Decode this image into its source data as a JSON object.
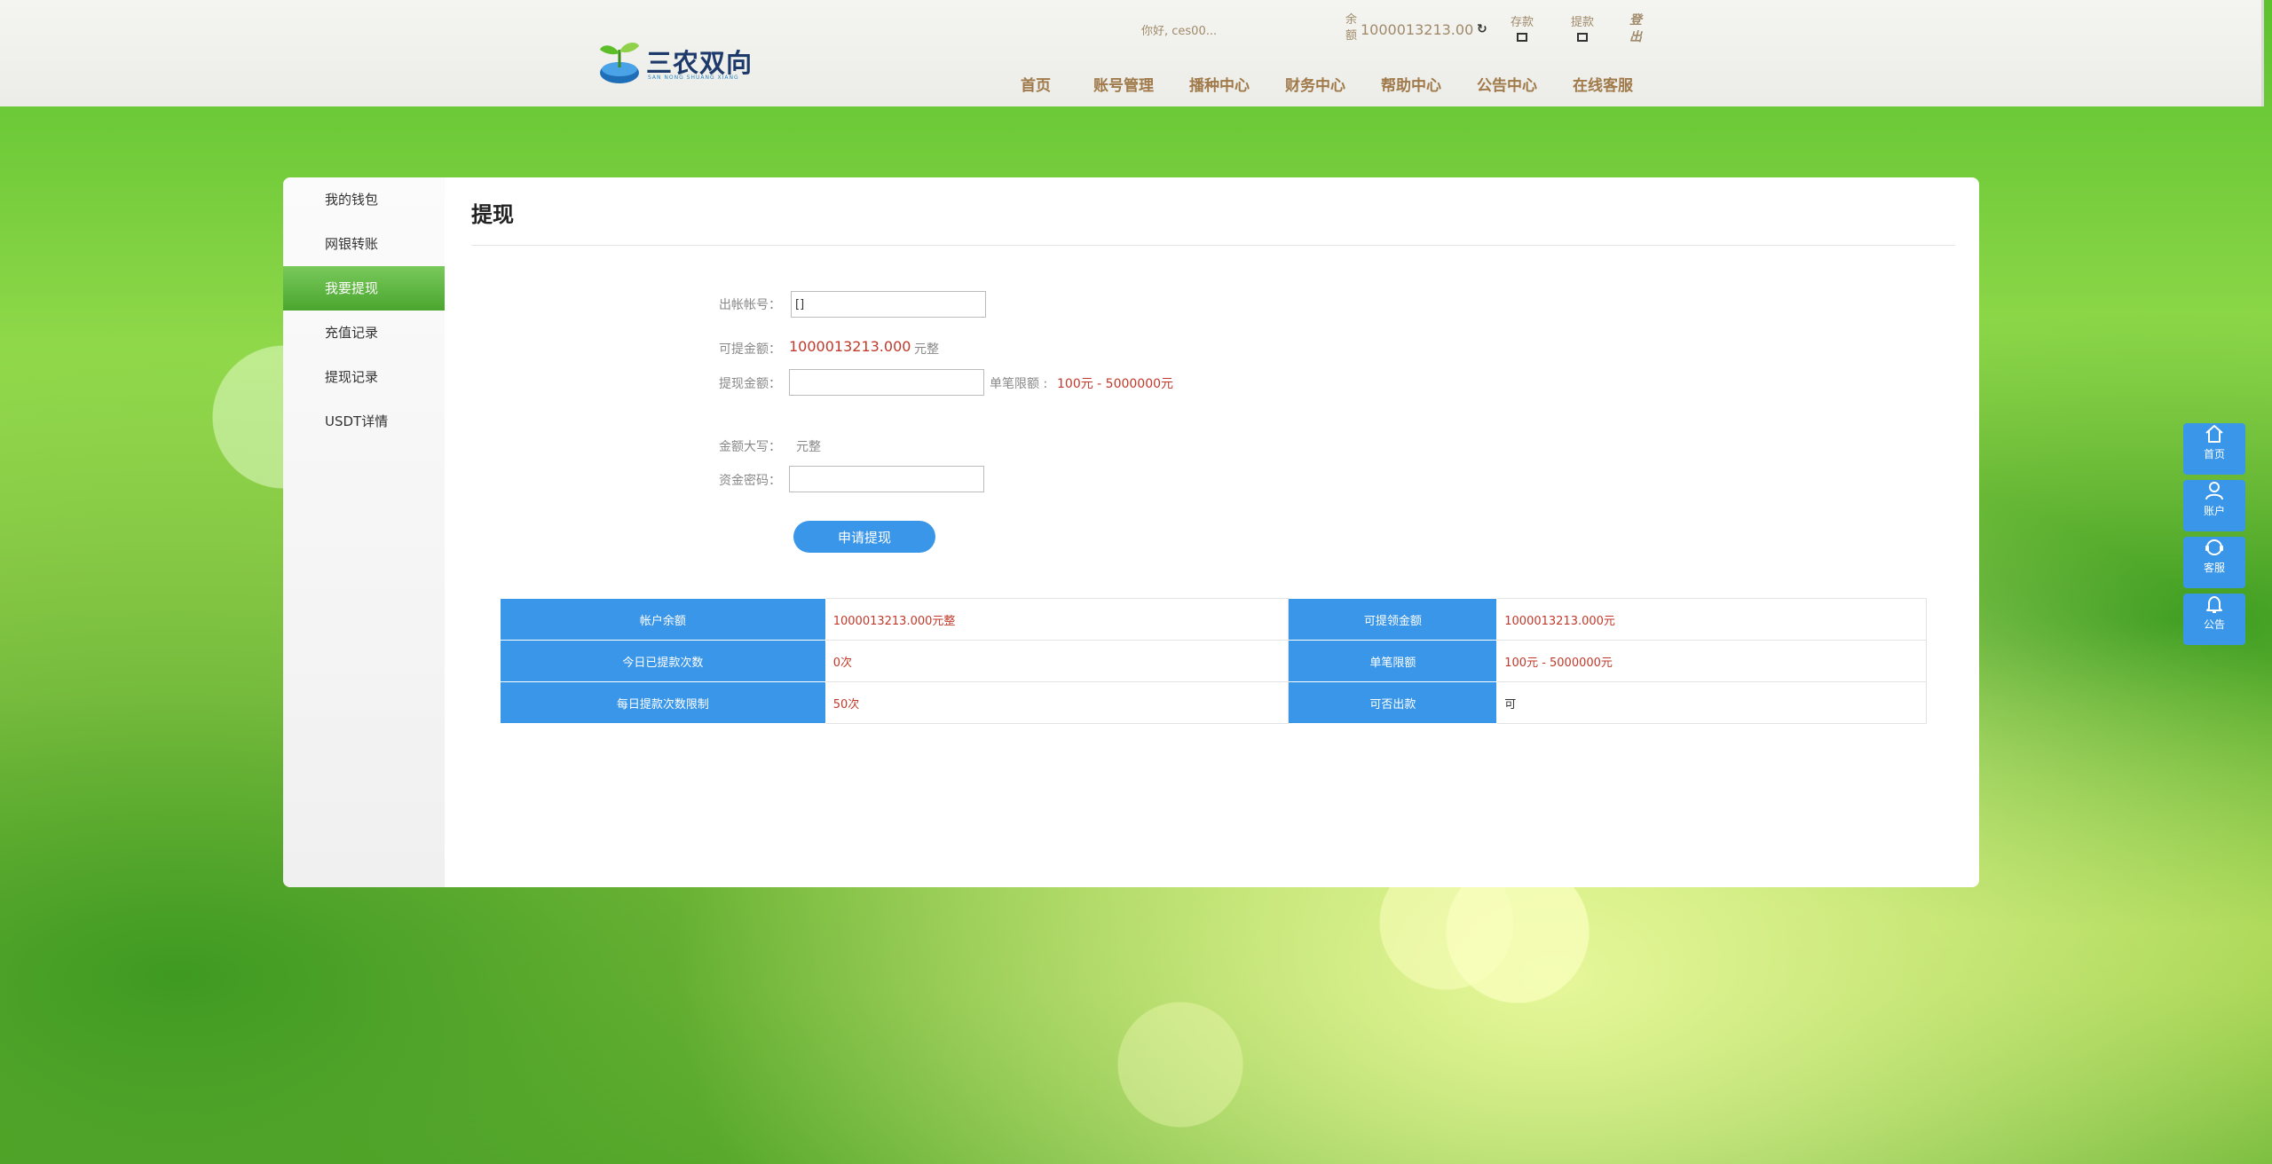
{
  "header": {
    "logo_text": "三农双向",
    "logo_sub": "SAN NONG SHUANG XIANG",
    "greeting": "你好, ces00...",
    "balance_label": "余额",
    "balance_value": "1000013213.00",
    "deposit_label": "存款",
    "withdraw_label": "提款",
    "logout_label": "登出",
    "nav": [
      "首页",
      "账号管理",
      "播种中心",
      "财务中心",
      "帮助中心",
      "公告中心",
      "在线客服"
    ]
  },
  "sidebar": {
    "items": [
      {
        "label": "我的钱包"
      },
      {
        "label": "网银转账"
      },
      {
        "label": "我要提现"
      },
      {
        "label": "充值记录"
      },
      {
        "label": "提现记录"
      },
      {
        "label": "USDT详情"
      }
    ],
    "active_index": 2
  },
  "main": {
    "title": "提现",
    "account_label": "出帐帐号：",
    "account_value": "[]",
    "available_label": "可提金额：",
    "available_value": "1000013213.000",
    "available_unit": "元整",
    "amount_label": "提现金额：",
    "amount_value": "",
    "limit_label": "单笔限额 :",
    "limit_value": "100元 - 5000000元",
    "uppercase_label": "金额大写：",
    "uppercase_unit": "元整",
    "password_label": "资金密码：",
    "password_value": "",
    "submit_label": "申请提现"
  },
  "info_table": {
    "rows": [
      {
        "l1": "帐户余额",
        "v1": "1000013213.000元整",
        "l2": "可提领金额",
        "v2": "1000013213.000元"
      },
      {
        "l1": "今日已提款次数",
        "v1": "0次",
        "l2": "单笔限额",
        "v2": "100元 - 5000000元"
      },
      {
        "l1": "每日提款次数限制",
        "v1": "50次",
        "l2": "可否出款",
        "v2": "可"
      }
    ]
  },
  "float_bar": {
    "items": [
      {
        "label": "首页",
        "icon": "home-icon"
      },
      {
        "label": "账户",
        "icon": "user-icon"
      },
      {
        "label": "客服",
        "icon": "headset-icon"
      },
      {
        "label": "公告",
        "icon": "bell-icon"
      }
    ]
  },
  "colors": {
    "accent_blue": "#3a96e8",
    "active_green": "#4aa62f",
    "amount_red": "#c0392b",
    "nav_brown": "#a07a4a"
  }
}
